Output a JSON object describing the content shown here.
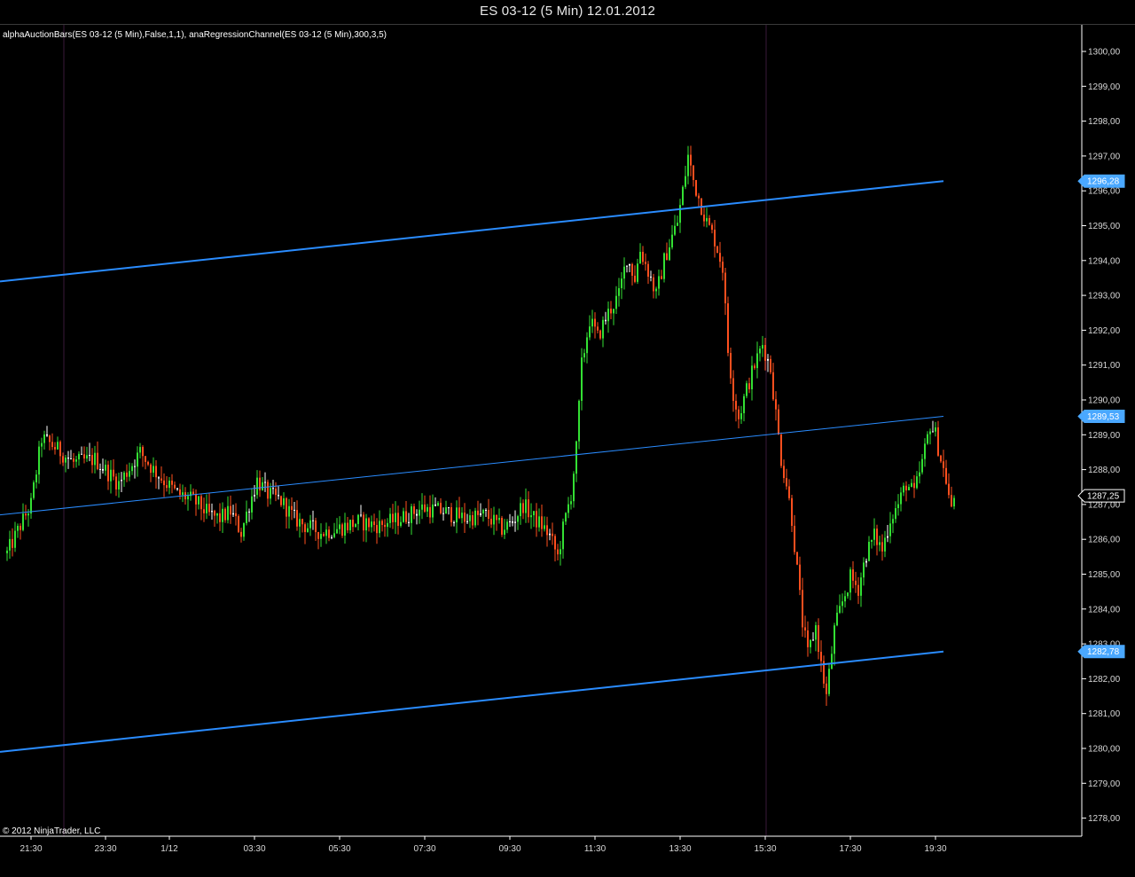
{
  "window": {
    "title": "ES 03-12 (5 Min)  12.01.2012"
  },
  "indicator_label": "alphaAuctionBars(ES 03-12 (5 Min),False,1,1), anaRegressionChannel(ES 03-12 (5 Min),300,3,5)",
  "copyright": "© 2012 NinjaTrader, LLC",
  "colors": {
    "background": "#000000",
    "bull_bar": "#33e033",
    "bear_bar": "#ff4f1e",
    "neutral_bar": "#ffffff",
    "channel": "#2a8cff",
    "separator": "#3a1a3a",
    "axis_line": "#ffffff",
    "badge": "#4aa8ff"
  },
  "chart_data": {
    "type": "candlestick",
    "title": "",
    "xlabel": "",
    "ylabel": "",
    "ylim": [
      1277.3,
      1300.6
    ],
    "y_ticks": [
      "1278,00",
      "1279,00",
      "1280,00",
      "1281,00",
      "1282,00",
      "1283,00",
      "1284,00",
      "1285,00",
      "1286,00",
      "1287,00",
      "1288,00",
      "1289,00",
      "1290,00",
      "1291,00",
      "1292,00",
      "1293,00",
      "1294,00",
      "1295,00",
      "1296,00",
      "1297,00",
      "1298,00",
      "1299,00",
      "1300,00"
    ],
    "x_ticks": [
      "21:30",
      "23:30",
      "1/12",
      "03:30",
      "05:30",
      "07:30",
      "09:30",
      "11:30",
      "13:30",
      "15:30",
      "17:30",
      "19:30"
    ],
    "session_separators": [
      "22:15 (11.01)",
      "15:30"
    ],
    "price_badges": [
      {
        "label": "1296,28",
        "value": 1296.28,
        "color": "#4aa8ff"
      },
      {
        "label": "1289,53",
        "value": 1289.53,
        "color": "#4aa8ff"
      },
      {
        "label": "1287,25",
        "value": 1287.25,
        "color": "#ffffff"
      },
      {
        "label": "1282,78",
        "value": 1282.78,
        "color": "#4aa8ff"
      }
    ],
    "regression_channel": {
      "upper": {
        "start": 1293.4,
        "end": 1296.28
      },
      "middle": {
        "start": 1286.7,
        "end": 1289.53
      },
      "lower": {
        "start": 1279.9,
        "end": 1282.78
      }
    },
    "price_path": [
      [
        0,
        1285.6
      ],
      [
        5,
        1286.4
      ],
      [
        9,
        1287.0
      ],
      [
        13,
        1288.9
      ],
      [
        17,
        1288.7
      ],
      [
        25,
        1288.2
      ],
      [
        33,
        1288.3
      ],
      [
        42,
        1287.6
      ],
      [
        50,
        1288.5
      ],
      [
        55,
        1288.0
      ],
      [
        60,
        1287.6
      ],
      [
        64,
        1287.3
      ],
      [
        68,
        1287.2
      ],
      [
        72,
        1287.0
      ],
      [
        76,
        1286.7
      ],
      [
        80,
        1286.6
      ],
      [
        84,
        1286.8
      ],
      [
        88,
        1286.2
      ],
      [
        91,
        1287.0
      ],
      [
        94,
        1287.7
      ],
      [
        98,
        1287.3
      ],
      [
        103,
        1287.1
      ],
      [
        108,
        1286.6
      ],
      [
        112,
        1286.4
      ],
      [
        118,
        1286.2
      ],
      [
        124,
        1286.3
      ],
      [
        132,
        1286.5
      ],
      [
        140,
        1286.4
      ],
      [
        148,
        1286.6
      ],
      [
        156,
        1286.9
      ],
      [
        164,
        1286.8
      ],
      [
        172,
        1286.6
      ],
      [
        180,
        1286.7
      ],
      [
        186,
        1286.3
      ],
      [
        190,
        1286.5
      ],
      [
        194,
        1287.0
      ],
      [
        198,
        1286.6
      ],
      [
        201,
        1286.4
      ],
      [
        204,
        1286.1
      ],
      [
        207,
        1285.5
      ],
      [
        209,
        1286.3
      ],
      [
        212,
        1287.3
      ],
      [
        214,
        1288.6
      ],
      [
        216,
        1291.0
      ],
      [
        219,
        1292.3
      ],
      [
        222,
        1291.8
      ],
      [
        226,
        1292.5
      ],
      [
        230,
        1293.0
      ],
      [
        233,
        1294.1
      ],
      [
        236,
        1293.5
      ],
      [
        238,
        1294.3
      ],
      [
        241,
        1293.7
      ],
      [
        244,
        1293.0
      ],
      [
        247,
        1294.0
      ],
      [
        250,
        1294.7
      ],
      [
        252,
        1295.1
      ],
      [
        254,
        1296.0
      ],
      [
        256,
        1297.0
      ],
      [
        258,
        1296.3
      ],
      [
        260,
        1295.8
      ],
      [
        263,
        1295.1
      ],
      [
        266,
        1294.6
      ],
      [
        269,
        1293.8
      ],
      [
        271,
        1291.4
      ],
      [
        273,
        1290.2
      ],
      [
        275,
        1289.5
      ],
      [
        278,
        1290.3
      ],
      [
        281,
        1291.0
      ],
      [
        284,
        1291.6
      ],
      [
        287,
        1290.9
      ],
      [
        289,
        1289.6
      ],
      [
        291,
        1288.3
      ],
      [
        293,
        1287.6
      ],
      [
        295,
        1286.6
      ],
      [
        297,
        1285.1
      ],
      [
        299,
        1283.6
      ],
      [
        301,
        1282.7
      ],
      [
        304,
        1283.5
      ],
      [
        306,
        1282.4
      ],
      [
        308,
        1281.5
      ],
      [
        311,
        1283.4
      ],
      [
        314,
        1284.2
      ],
      [
        317,
        1284.9
      ],
      [
        320,
        1284.6
      ],
      [
        323,
        1285.6
      ],
      [
        326,
        1286.1
      ],
      [
        329,
        1285.7
      ],
      [
        332,
        1286.6
      ],
      [
        335,
        1287.0
      ],
      [
        338,
        1287.6
      ],
      [
        341,
        1287.3
      ],
      [
        344,
        1288.2
      ],
      [
        347,
        1289.3
      ],
      [
        349,
        1289.0
      ],
      [
        351,
        1288.3
      ],
      [
        353,
        1287.7
      ],
      [
        355,
        1286.8
      ],
      [
        356,
        1287.2
      ]
    ]
  }
}
